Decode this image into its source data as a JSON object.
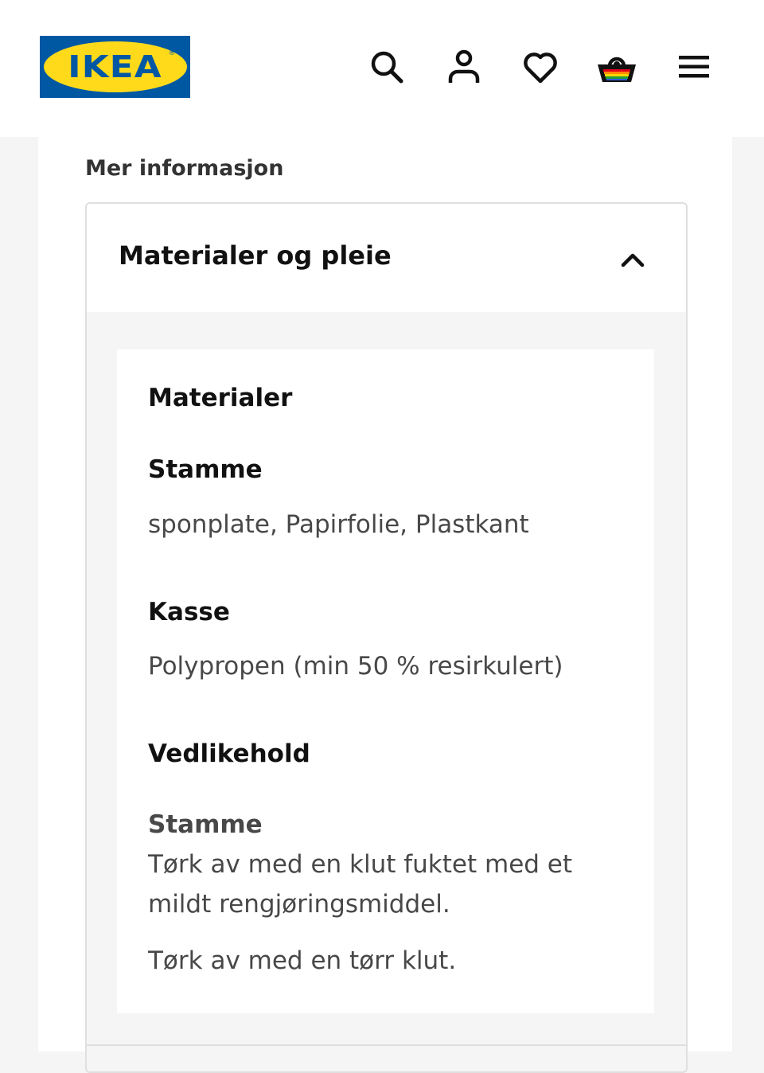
{
  "header": {
    "logo_text": "IKEA",
    "logo_reg": "®",
    "colors": {
      "logo_blue": "#0058a3",
      "logo_yellow": "#ffda1a"
    },
    "icons": [
      "search-icon",
      "user-icon",
      "heart-icon",
      "basket-icon",
      "menu-icon"
    ]
  },
  "section": {
    "heading": "Mer informasjon"
  },
  "accordion": {
    "title": "Materialer og pleie",
    "expanded": true,
    "materials_heading": "Materialer",
    "materials": [
      {
        "part": "Stamme",
        "value": "sponplate, Papirfolie, Plastkant"
      },
      {
        "part": "Kasse",
        "value": "Polypropen (min 50 % resirkulert)"
      }
    ],
    "care_heading": "Vedlikehold",
    "care": {
      "part": "Stamme",
      "lines": [
        "Tørk av med en klut fuktet med et",
        "mildt rengjøringsmiddel."
      ],
      "extra": "Tørk av med en tørr klut."
    }
  }
}
